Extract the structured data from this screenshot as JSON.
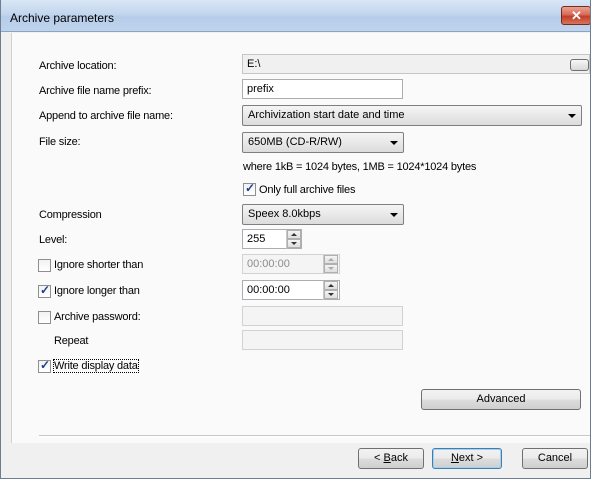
{
  "window": {
    "title": "Archive parameters",
    "close_glyph": "✕"
  },
  "form": {
    "archive_location": {
      "label": "Archive location:",
      "value": "E:\\"
    },
    "prefix": {
      "label": "Archive file name prefix:",
      "value": "prefix"
    },
    "append": {
      "label": "Append to archive file name:",
      "value": "Archivization start date and time"
    },
    "file_size": {
      "label": "File size:",
      "value": "650MB (CD-R/RW)",
      "note": "where 1kB = 1024 bytes,  1MB = 1024*1024 bytes"
    },
    "only_full": {
      "label": "Only full archive files",
      "checked": true
    },
    "compression": {
      "label": "Compression",
      "value": "Speex 8.0kbps"
    },
    "level": {
      "label": "Level:",
      "value": "255"
    },
    "ignore_shorter": {
      "label": "Ignore shorter than",
      "checked": false,
      "value": "00:00:00"
    },
    "ignore_longer": {
      "label": "Ignore longer than",
      "checked": true,
      "value": "00:00:00"
    },
    "password": {
      "label": "Archive password:",
      "checked": false,
      "value": ""
    },
    "repeat": {
      "label": "Repeat",
      "value": ""
    },
    "write_display": {
      "label": "Write display data",
      "checked": true
    },
    "advanced_label": "Advanced"
  },
  "footer": {
    "back_label_pre": "< ",
    "back_label_mnemonic": "B",
    "back_label_post": "ack",
    "next_label_mnemonic": "N",
    "next_label_post": "ext >",
    "cancel_label": "Cancel"
  }
}
